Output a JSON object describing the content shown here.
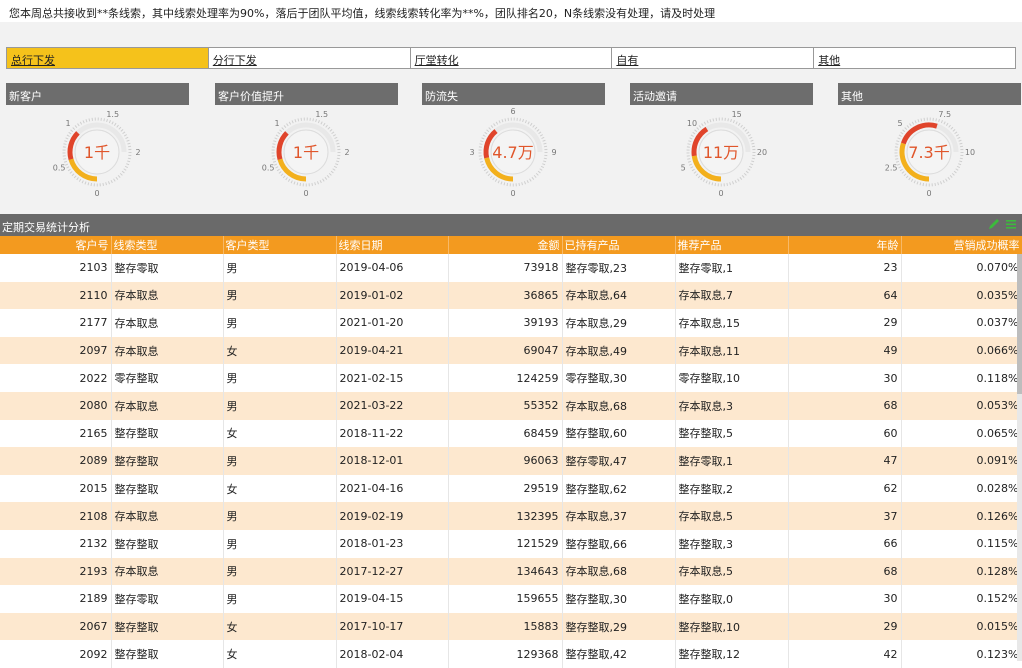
{
  "notice": "您本周总共接收到**条线索，其中线索处理率为90%，落后于团队平均值，线索线索转化率为**%，团队排名20，N条线索没有处理，请及时处理",
  "tabs": [
    {
      "label": "总行下发",
      "active": true
    },
    {
      "label": "分行下发",
      "active": false
    },
    {
      "label": "厅堂转化",
      "active": false
    },
    {
      "label": "自有",
      "active": false
    },
    {
      "label": "其他",
      "active": false
    }
  ],
  "gauges": [
    {
      "title": "新客户",
      "value_label": "1千",
      "value": 1,
      "ticks": [
        "0",
        "0.5",
        "1",
        "1.5",
        "2"
      ],
      "max": 2
    },
    {
      "title": "客户价值提升",
      "value_label": "1千",
      "value": 1,
      "ticks": [
        "0",
        "0.5",
        "1",
        "1.5",
        "2"
      ],
      "max": 2
    },
    {
      "title": "防流失",
      "value_label": "4.7万",
      "value": 4.7,
      "ticks": [
        "0",
        "3",
        "6",
        "9"
      ],
      "max": 9
    },
    {
      "title": "活动邀请",
      "value_label": "11万",
      "value": 11,
      "ticks": [
        "0",
        "5",
        "10",
        "15",
        "20"
      ],
      "max": 20
    },
    {
      "title": "其他",
      "value_label": "7.3千",
      "value": 7.3,
      "ticks": [
        "0",
        "2.5",
        "5",
        "7.5",
        "10"
      ],
      "max": 10
    }
  ],
  "section_title": "定期交易统计分析",
  "colors": {
    "accent": "#f39a1f",
    "active_tab": "#f5c21b",
    "gauge_red": "#e0442b",
    "gauge_yellow": "#f3b01c",
    "header_gray": "#6d6d6d"
  },
  "table": {
    "headers": [
      "客户号",
      "线索类型",
      "客户类型",
      "线索日期",
      "金额",
      "已持有产品",
      "推荐产品",
      "年龄",
      "营销成功概率"
    ],
    "rows": [
      [
        "2103",
        "整存零取",
        "男",
        "2019-04-06",
        "73918",
        "整存零取,23",
        "整存零取,1",
        "23",
        "0.070%"
      ],
      [
        "2110",
        "存本取息",
        "男",
        "2019-01-02",
        "36865",
        "存本取息,64",
        "存本取息,7",
        "64",
        "0.035%"
      ],
      [
        "2177",
        "存本取息",
        "男",
        "2021-01-20",
        "39193",
        "存本取息,29",
        "存本取息,15",
        "29",
        "0.037%"
      ],
      [
        "2097",
        "存本取息",
        "女",
        "2019-04-21",
        "69047",
        "存本取息,49",
        "存本取息,11",
        "49",
        "0.066%"
      ],
      [
        "2022",
        "零存整取",
        "男",
        "2021-02-15",
        "124259",
        "零存整取,30",
        "零存整取,10",
        "30",
        "0.118%"
      ],
      [
        "2080",
        "存本取息",
        "男",
        "2021-03-22",
        "55352",
        "存本取息,68",
        "存本取息,3",
        "68",
        "0.053%"
      ],
      [
        "2165",
        "整存整取",
        "女",
        "2018-11-22",
        "68459",
        "整存整取,60",
        "整存整取,5",
        "60",
        "0.065%"
      ],
      [
        "2089",
        "整存整取",
        "男",
        "2018-12-01",
        "96063",
        "整存零取,47",
        "整存零取,1",
        "47",
        "0.091%"
      ],
      [
        "2015",
        "整存整取",
        "女",
        "2021-04-16",
        "29519",
        "整存整取,62",
        "整存整取,2",
        "62",
        "0.028%"
      ],
      [
        "2108",
        "存本取息",
        "男",
        "2019-02-19",
        "132395",
        "存本取息,37",
        "存本取息,5",
        "37",
        "0.126%"
      ],
      [
        "2132",
        "整存整取",
        "男",
        "2018-01-23",
        "121529",
        "整存整取,66",
        "整存整取,3",
        "66",
        "0.115%"
      ],
      [
        "2193",
        "存本取息",
        "男",
        "2017-12-27",
        "134643",
        "存本取息,68",
        "存本取息,5",
        "68",
        "0.128%"
      ],
      [
        "2189",
        "整存零取",
        "男",
        "2019-04-15",
        "159655",
        "整存整取,30",
        "整存整取,0",
        "30",
        "0.152%"
      ],
      [
        "2067",
        "整存整取",
        "女",
        "2017-10-17",
        "15883",
        "整存整取,29",
        "整存整取,10",
        "29",
        "0.015%"
      ],
      [
        "2092",
        "整存整取",
        "女",
        "2018-02-04",
        "129368",
        "整存整取,42",
        "整存整取,12",
        "42",
        "0.123%"
      ]
    ]
  }
}
